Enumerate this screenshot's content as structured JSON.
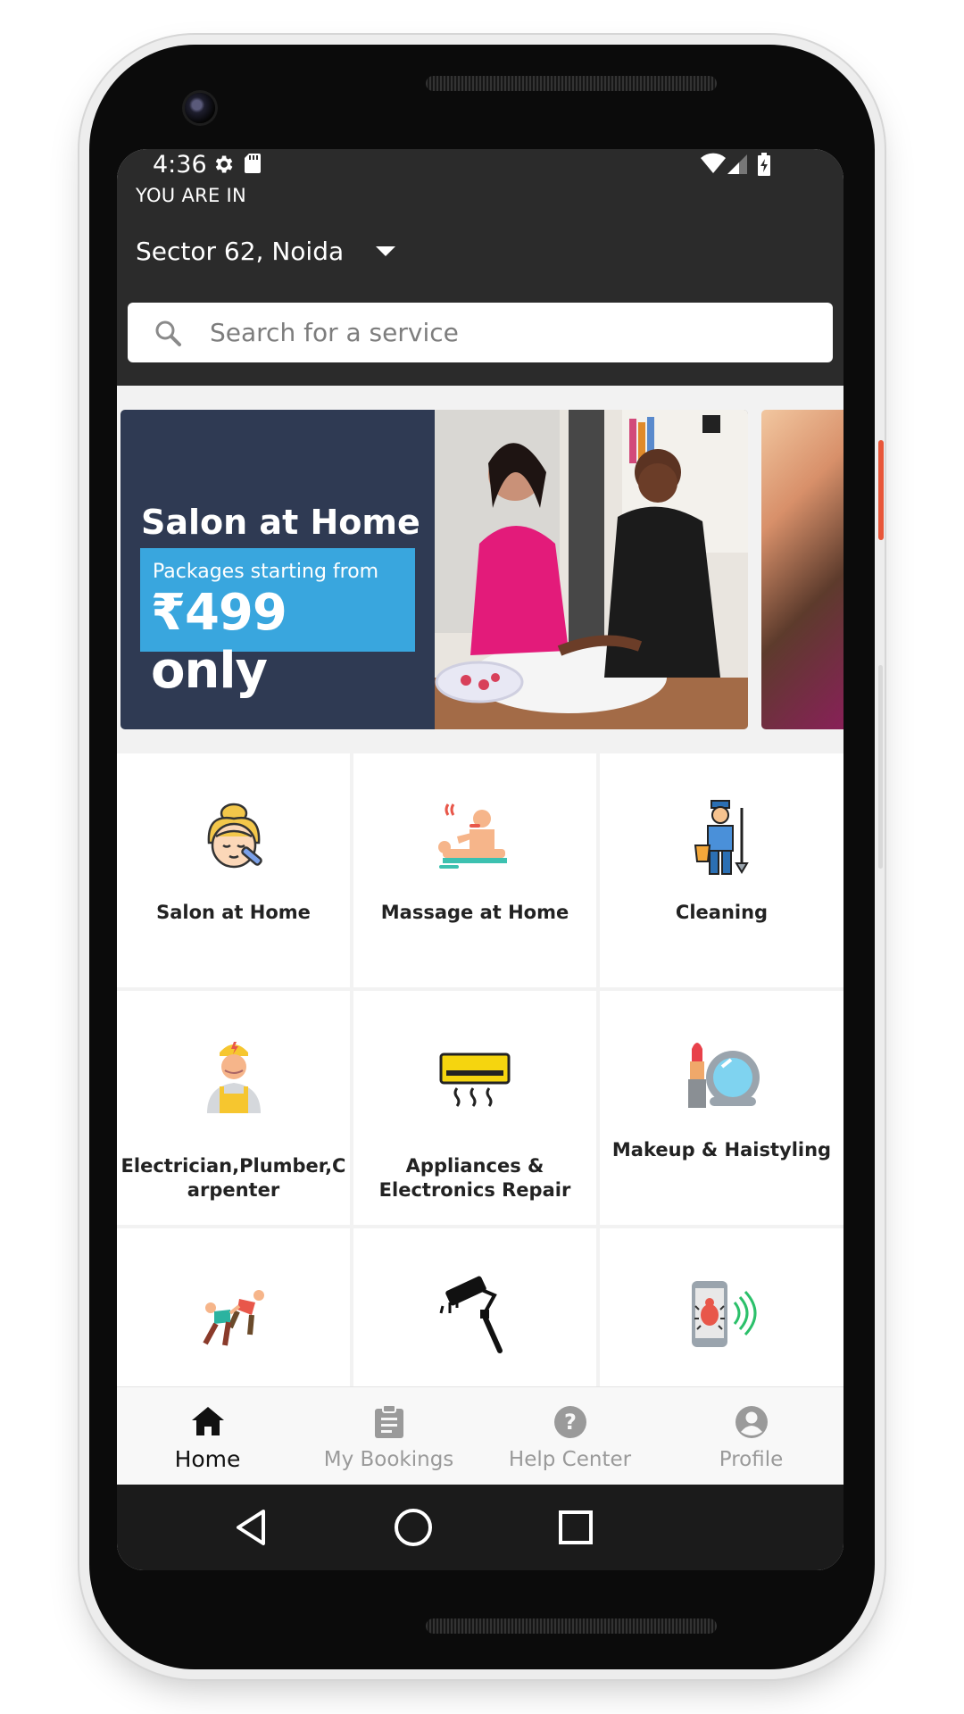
{
  "status_bar": {
    "time": "4:36"
  },
  "header": {
    "you_are_in": "YOU ARE IN",
    "location": "Sector 62, Noida"
  },
  "search": {
    "placeholder": "Search for a service"
  },
  "banner": {
    "title": "Salon at Home",
    "promo_line1": "Packages starting from",
    "promo_line2": "₹499 only"
  },
  "categories": [
    {
      "label": "Salon at Home",
      "icon": "salon-icon"
    },
    {
      "label": "Massage at Home",
      "icon": "massage-icon"
    },
    {
      "label": "Cleaning",
      "icon": "cleaning-icon"
    },
    {
      "label": "Electrician,Plumber,C arpenter",
      "icon": "electrician-icon"
    },
    {
      "label": "Appliances & Electronics Repair",
      "icon": "air-conditioner-icon"
    },
    {
      "label": "Makeup & Haistyling",
      "icon": "makeup-icon"
    },
    {
      "label": "",
      "icon": "fitness-icon"
    },
    {
      "label": "",
      "icon": "paint-roller-icon"
    },
    {
      "label": "",
      "icon": "pest-control-phone-icon"
    }
  ],
  "bottom_nav": [
    {
      "label": "Home",
      "icon": "home-icon",
      "active": true
    },
    {
      "label": "My Bookings",
      "icon": "clipboard-icon",
      "active": false
    },
    {
      "label": "Help Center",
      "icon": "help-icon",
      "active": false
    },
    {
      "label": "Profile",
      "icon": "profile-icon",
      "active": false
    }
  ],
  "colors": {
    "header_bg": "#2b2b2b",
    "banner_bg": "#2f3a53",
    "promo_blue": "#39a6de",
    "nav_active": "#111111",
    "nav_inactive": "#9a9a9a"
  }
}
